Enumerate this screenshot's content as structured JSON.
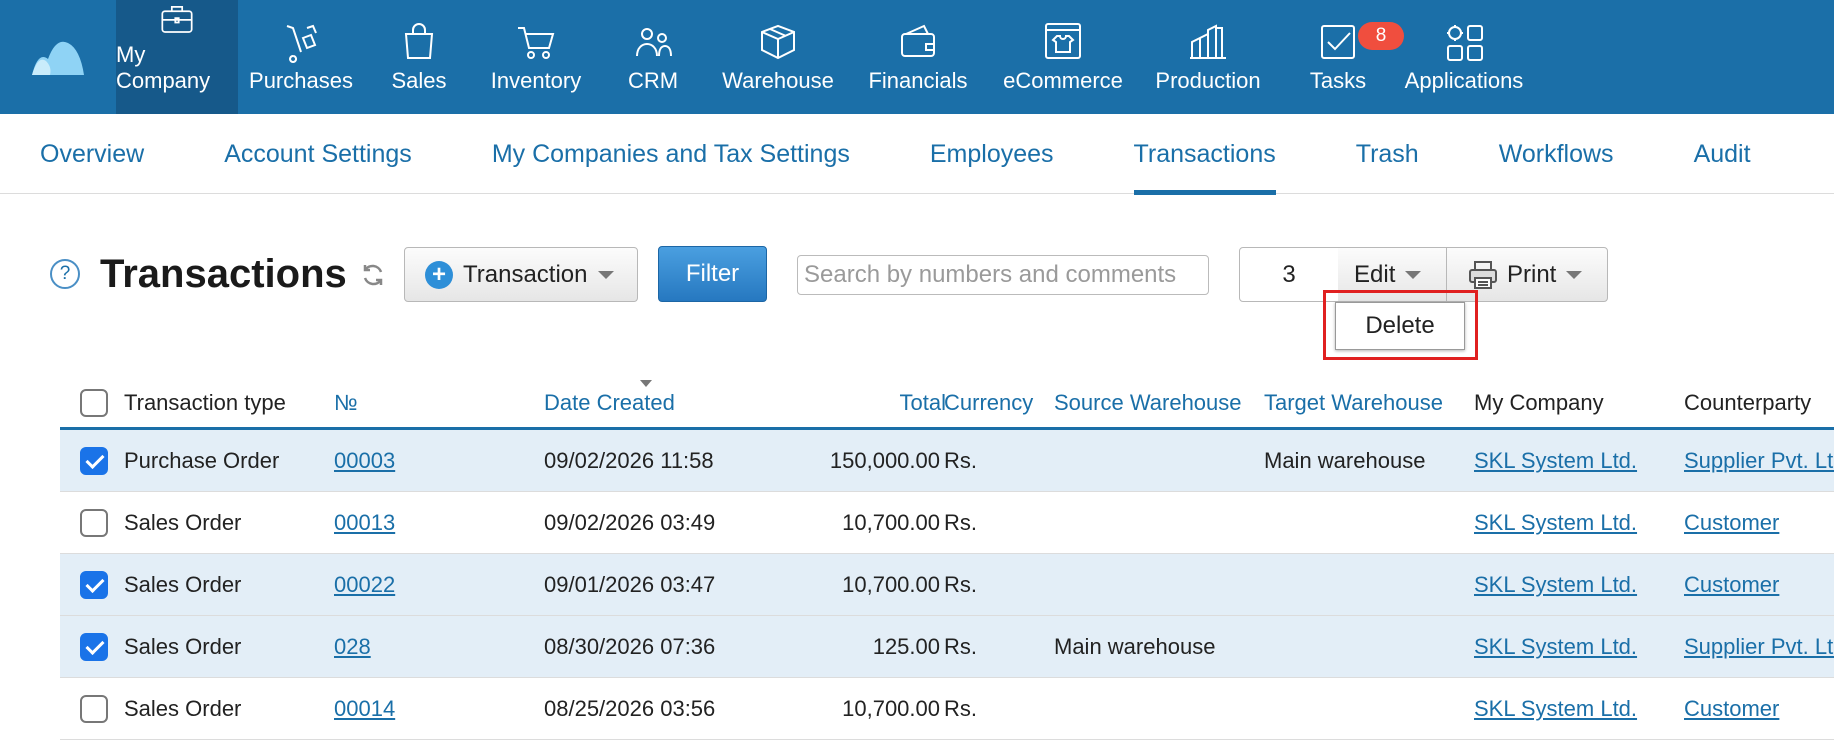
{
  "topnav": {
    "items": [
      {
        "label": "My Company",
        "icon": "briefcase-icon"
      },
      {
        "label": "Purchases",
        "icon": "hand-truck-icon"
      },
      {
        "label": "Sales",
        "icon": "shopping-bag-icon"
      },
      {
        "label": "Inventory",
        "icon": "cart-icon"
      },
      {
        "label": "CRM",
        "icon": "people-icon"
      },
      {
        "label": "Warehouse",
        "icon": "box-icon"
      },
      {
        "label": "Financials",
        "icon": "wallet-icon"
      },
      {
        "label": "eCommerce",
        "icon": "storefront-icon"
      },
      {
        "label": "Production",
        "icon": "factory-icon"
      },
      {
        "label": "Tasks",
        "icon": "checkbox-icon",
        "badge": "8"
      },
      {
        "label": "Applications",
        "icon": "apps-grid-icon"
      }
    ],
    "active_index": 0,
    "bg_color": "#1b6fa8"
  },
  "subnav": {
    "tabs": [
      "Overview",
      "Account Settings",
      "My Companies and Tax Settings",
      "Employees",
      "Transactions",
      "Trash",
      "Workflows",
      "Audit"
    ],
    "active": "Transactions"
  },
  "page": {
    "help_label": "?",
    "title": "Transactions",
    "transaction_button": "Transaction",
    "filter_button": "Filter",
    "search_placeholder": "Search by numbers and comments",
    "selected_count": "3",
    "edit_button": "Edit",
    "print_button": "Print",
    "dropdown_item": "Delete"
  },
  "table": {
    "headers": [
      "Transaction type",
      "№",
      "Date Created",
      "Total",
      "Currency",
      "Source Warehouse",
      "Target Warehouse",
      "My Company",
      "Counterparty"
    ],
    "rows": [
      {
        "checked": true,
        "type": "Purchase Order",
        "number": "00003",
        "date": "09/02/2026 11:58",
        "total": "150,000.00",
        "currency": "Rs.",
        "source": "",
        "target": "Main warehouse",
        "company": "SKL System Ltd.",
        "counterparty": "Supplier Pvt. Ltd."
      },
      {
        "checked": false,
        "type": "Sales Order",
        "number": "00013",
        "date": "09/02/2026 03:49",
        "total": "10,700.00",
        "currency": "Rs.",
        "source": "",
        "target": "",
        "company": "SKL System Ltd.",
        "counterparty": "Customer"
      },
      {
        "checked": true,
        "type": "Sales Order",
        "number": "00022",
        "date": "09/01/2026 03:47",
        "total": "10,700.00",
        "currency": "Rs.",
        "source": "",
        "target": "",
        "company": "SKL System Ltd.",
        "counterparty": "Customer"
      },
      {
        "checked": true,
        "type": "Sales Order",
        "number": "028",
        "date": "08/30/2026 07:36",
        "total": "125.00",
        "currency": "Rs.",
        "source": "Main warehouse",
        "target": "",
        "company": "SKL System Ltd.",
        "counterparty": "Supplier Pvt. Ltd."
      },
      {
        "checked": false,
        "type": "Sales Order",
        "number": "00014",
        "date": "08/25/2026 03:56",
        "total": "10,700.00",
        "currency": "Rs.",
        "source": "",
        "target": "",
        "company": "SKL System Ltd.",
        "counterparty": "Customer"
      }
    ]
  }
}
